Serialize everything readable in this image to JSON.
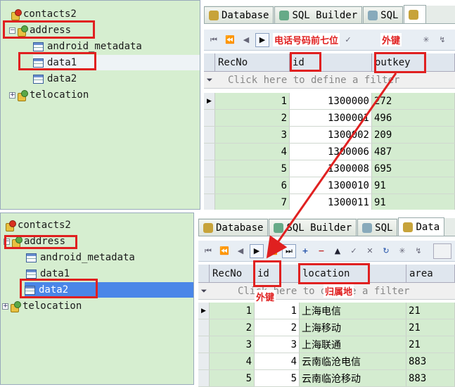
{
  "top": {
    "tree": [
      {
        "label": "contacts2",
        "type": "db-red",
        "level": 0
      },
      {
        "label": "address",
        "type": "db",
        "level": 0,
        "expanded": true
      },
      {
        "label": "android_metadata",
        "type": "table",
        "level": 1
      },
      {
        "label": "data1",
        "type": "table",
        "level": 1
      },
      {
        "label": "data2",
        "type": "table",
        "level": 1
      },
      {
        "label": "telocation",
        "type": "db",
        "level": 0
      }
    ],
    "tabs": [
      "Database",
      "SQL Builder",
      "SQL",
      ""
    ],
    "annotations": {
      "phone_prefix": "电话号码前七位",
      "foreign_key": "外键"
    },
    "columns": [
      "RecNo",
      "id",
      "outkey"
    ],
    "filter_placeholder": "Click here to define a filter",
    "rows": [
      {
        "recno": "1",
        "id": "1300000",
        "outkey": "272"
      },
      {
        "recno": "2",
        "id": "1300001",
        "outkey": "496"
      },
      {
        "recno": "3",
        "id": "1300002",
        "outkey": "209"
      },
      {
        "recno": "4",
        "id": "1300006",
        "outkey": "487"
      },
      {
        "recno": "5",
        "id": "1300008",
        "outkey": "695"
      },
      {
        "recno": "6",
        "id": "1300010",
        "outkey": "91"
      },
      {
        "recno": "7",
        "id": "1300011",
        "outkey": "91"
      }
    ]
  },
  "bottom": {
    "tree": [
      {
        "label": "contacts2",
        "type": "db-red",
        "level": 0
      },
      {
        "label": "address",
        "type": "db",
        "level": 0,
        "expanded": true
      },
      {
        "label": "android_metadata",
        "type": "table",
        "level": 1
      },
      {
        "label": "data1",
        "type": "table",
        "level": 1
      },
      {
        "label": "data2",
        "type": "table",
        "level": 1
      },
      {
        "label": "telocation",
        "type": "db",
        "level": 0
      }
    ],
    "tabs": [
      "Database",
      "SQL Builder",
      "SQL",
      "Data"
    ],
    "annotations": {
      "foreign_key": "外键",
      "region": "归属地"
    },
    "columns": [
      "RecNo",
      "id",
      "location",
      "area"
    ],
    "filter_placeholder": "Click here to define a filter",
    "rows": [
      {
        "recno": "1",
        "id": "1",
        "location": "上海电信",
        "area": "21"
      },
      {
        "recno": "2",
        "id": "2",
        "location": "上海移动",
        "area": "21"
      },
      {
        "recno": "3",
        "id": "3",
        "location": "上海联通",
        "area": "21"
      },
      {
        "recno": "4",
        "id": "4",
        "location": "云南临沧电信",
        "area": "883"
      },
      {
        "recno": "5",
        "id": "5",
        "location": "云南临沧移动",
        "area": "883"
      }
    ]
  }
}
